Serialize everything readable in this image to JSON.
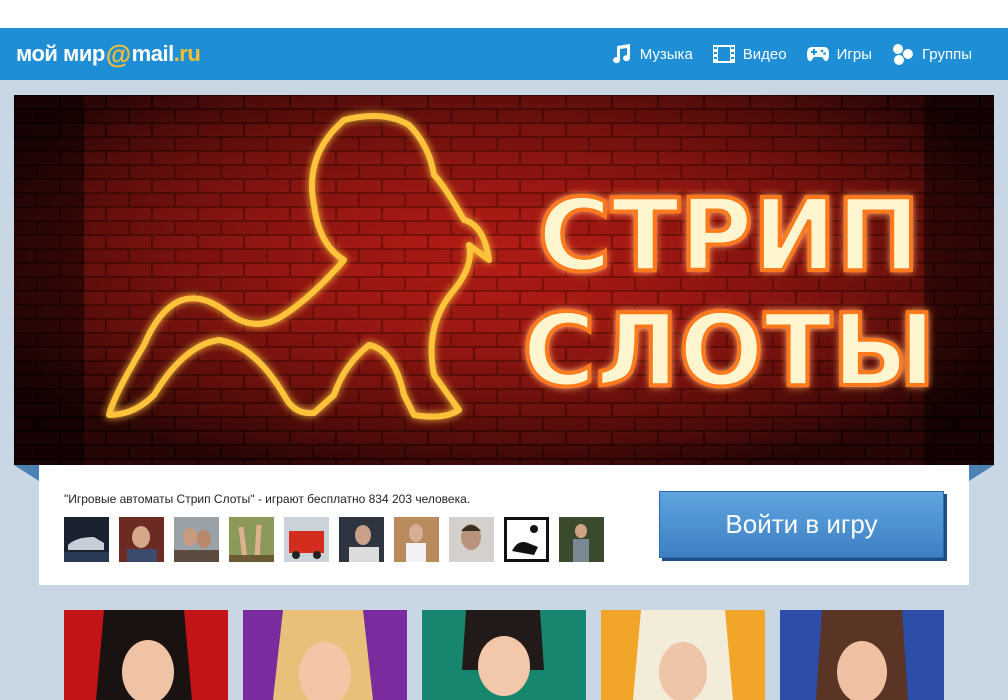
{
  "header": {
    "logo_main": "мой мир",
    "logo_at": "@",
    "logo_mail": "mail",
    "logo_ru": ".ru",
    "nav": [
      {
        "label": "Музыка",
        "icon": "music-note-icon"
      },
      {
        "label": "Видео",
        "icon": "film-icon"
      },
      {
        "label": "Игры",
        "icon": "gamepad-icon"
      },
      {
        "label": "Группы",
        "icon": "groups-icon"
      }
    ]
  },
  "banner": {
    "title_line1": "СТРИП",
    "title_line2": "СЛОТЫ"
  },
  "info": {
    "players_text": "\"Игровые автоматы Стрип Слоты\" - играют бесплатно 834 203 человека.",
    "enter_button": "Войти в игру"
  },
  "colors": {
    "header_bg": "#1e8ed6",
    "logo_accent": "#fdbf2d",
    "button_bg": "#4a8fd0",
    "page_bg": "#c9d6e3"
  }
}
